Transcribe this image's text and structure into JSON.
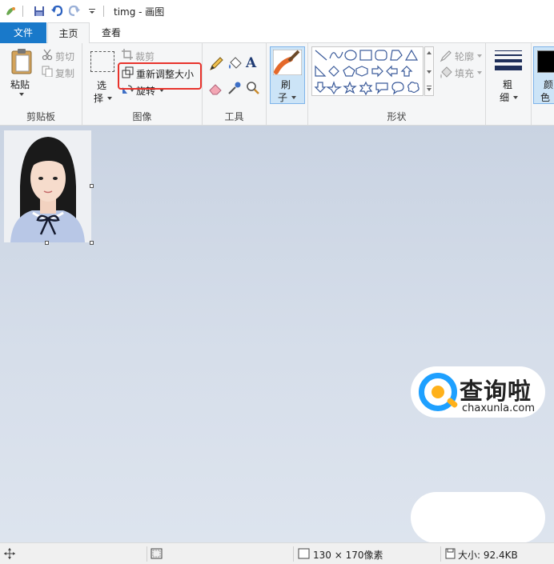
{
  "titlebar": {
    "title": "timg - 画图"
  },
  "tabs": {
    "file": "文件",
    "home": "主页",
    "view": "查看"
  },
  "clipboard": {
    "paste": "粘贴",
    "cut": "剪切",
    "copy": "复制",
    "group": "剪贴板"
  },
  "image": {
    "select_1": "选",
    "select_2": "择",
    "crop": "裁剪",
    "resize": "重新调整大小",
    "rotate": "旋转",
    "group": "图像"
  },
  "tools": {
    "text_tool": "A",
    "group": "工具"
  },
  "brush": {
    "label_1": "刷",
    "label_2": "子"
  },
  "shapes": {
    "outline": "轮廓",
    "fill": "填充",
    "group": "形状"
  },
  "size": {
    "label_1": "粗",
    "label_2": "细"
  },
  "color": {
    "label_1": "颜",
    "label_2": "色"
  },
  "status": {
    "dimensions": "130 × 170像素",
    "file_size": "大小: 92.4KB"
  },
  "watermark": {
    "name": "查询啦",
    "url": "chaxunla.com"
  },
  "colors": {
    "accent": "#1979ca",
    "highlight": "#e8332c"
  }
}
